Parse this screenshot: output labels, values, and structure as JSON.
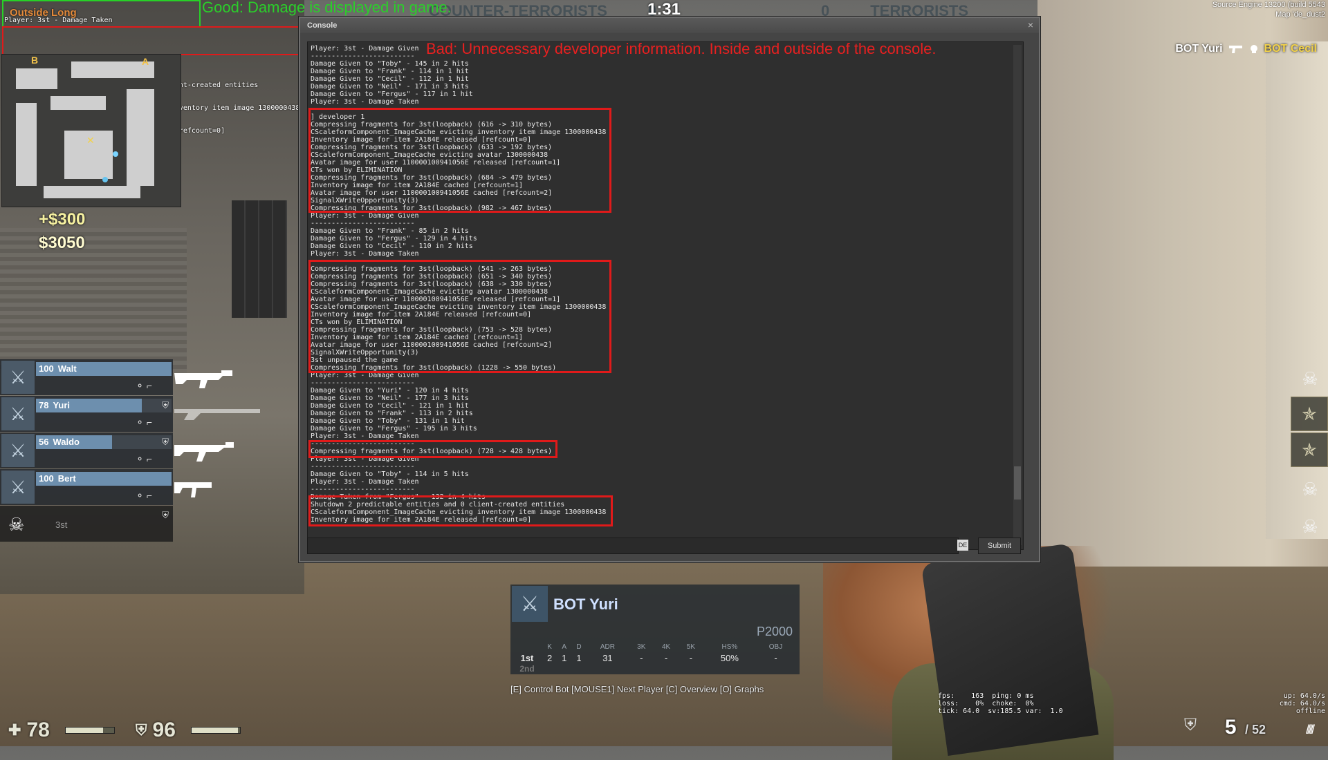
{
  "top": {
    "timer": "1:31",
    "team_left": "COUNTER-TERRORISTS",
    "team_left_score": "0",
    "team_right": "TERRORISTS",
    "team_right_score": "0",
    "engine_line1": "Source Engine 13200 (build 5543",
    "engine_line2": "Map 'de_dust2"
  },
  "killfeed": {
    "killer": "BOT Yuri",
    "victim": "BOT Cecil"
  },
  "overlay": {
    "line1": "Player: 3st - Damage Taken",
    "location": "Outside Long",
    "line2": "Damage Taken from \"Fergus\" - 132 in 4 hits",
    "dev1": "Shutdown 2 predictable entities and 0 client-created entities",
    "dev2": "CScaleformComponent_ImageCache evicting inventory item image 1300000438",
    "dev3": "Inventory image for item 2A184E released [refcount=0]"
  },
  "annotations": {
    "good": "Good: Damage is displayed in game.",
    "bad": "Bad: Unnecessary developer information. Inside and outside of the console."
  },
  "radar": {
    "site_b": "B",
    "site_a": "A"
  },
  "money": {
    "delta": "+$300",
    "total": "$3050"
  },
  "team": [
    {
      "hp": "100",
      "name": "Walt",
      "hp_frac": 1.0,
      "armor": ""
    },
    {
      "hp": "78",
      "name": "Yuri",
      "hp_frac": 0.78,
      "armor": "⛨"
    },
    {
      "hp": "56",
      "name": "Waldo",
      "hp_frac": 0.56,
      "armor": "⛨"
    },
    {
      "hp": "100",
      "name": "Bert",
      "hp_frac": 1.0,
      "armor": ""
    },
    {
      "hp": "",
      "name": "3st",
      "hp_frac": 0,
      "armor": "⛨",
      "dead": true
    }
  ],
  "console": {
    "title": "Console",
    "close": "×",
    "lang": "DE",
    "submit": "Submit",
    "lines": [
      "Player: 3st - Damage Given",
      "-------------------------",
      "Damage Given to \"Toby\" - 145 in 2 hits",
      "Damage Given to \"Frank\" - 114 in 1 hit",
      "Damage Given to \"Cecil\" - 112 in 1 hit",
      "Damage Given to \"Neil\" - 171 in 3 hits",
      "Damage Given to \"Fergus\" - 117 in 1 hit",
      "Player: 3st - Damage Taken",
      "-------------------------",
      "",
      "] developer 1",
      "Compressing fragments for 3st(loopback) (616 -> 310 bytes)",
      "CScaleformComponent_ImageCache evicting inventory item image 1300000438",
      "Inventory image for item 2A184E released [refcount=0]",
      "Compressing fragments for 3st(loopback) (633 -> 192 bytes)",
      "CScaleformComponent_ImageCache evicting avatar 1300000438",
      "Avatar image for user 110000100941056E released [refcount=1]",
      "CTs won by ELIMINATION",
      "Compressing fragments for 3st(loopback) (684 -> 479 bytes)",
      "Inventory image for item 2A184E cached [refcount=1]",
      "Avatar image for user 110000100941056E cached [refcount=2]",
      "SignalXWriteOpportunity(3)",
      "Compressing fragments for 3st(loopback) (982 -> 467 bytes)",
      "Player: 3st - Damage Given",
      "-------------------------",
      "Damage Given to \"Frank\" - 85 in 2 hits",
      "Damage Given to \"Fergus\" - 129 in 4 hits",
      "Damage Given to \"Cecil\" - 110 in 2 hits",
      "Player: 3st - Damage Taken",
      "-------------------------",
      "",
      "Compressing fragments for 3st(loopback) (541 -> 263 bytes)",
      "Compressing fragments for 3st(loopback) (651 -> 340 bytes)",
      "Compressing fragments for 3st(loopback) (638 -> 330 bytes)",
      "CScaleformComponent_ImageCache evicting avatar 1300000438",
      "Avatar image for user 110000100941056E released [refcount=1]",
      "CScaleformComponent_ImageCache evicting inventory item image 1300000438",
      "Inventory image for item 2A184E released [refcount=0]",
      "CTs won by ELIMINATION",
      "Compressing fragments for 3st(loopback) (753 -> 528 bytes)",
      "Inventory image for item 2A184E cached [refcount=1]",
      "Avatar image for user 110000100941056E cached [refcount=2]",
      "SignalXWriteOpportunity(3)",
      "3st unpaused the game",
      "Compressing fragments for 3st(loopback) (1228 -> 550 bytes)",
      "Player: 3st - Damage Given",
      "-------------------------",
      "Damage Given to \"Yuri\" - 120 in 4 hits",
      "Damage Given to \"Neil\" - 177 in 3 hits",
      "Damage Given to \"Cecil\" - 121 in 1 hit",
      "Damage Given to \"Frank\" - 113 in 2 hits",
      "Damage Given to \"Toby\" - 131 in 1 hit",
      "Damage Given to \"Fergus\" - 195 in 3 hits",
      "Player: 3st - Damage Taken",
      "-------------------------",
      "Compressing fragments for 3st(loopback) (728 -> 428 bytes)",
      "Player: 3st - Damage Given",
      "-------------------------",
      "Damage Given to \"Toby\" - 114 in 5 hits",
      "Player: 3st - Damage Taken",
      "-------------------------",
      "Damage Taken from \"Fergus\" - 132 in 4 hits",
      "Shutdown 2 predictable entities and 0 client-created entities",
      "CScaleformComponent_ImageCache evicting inventory item image 1300000438",
      "Inventory image for item 2A184E released [refcount=0]"
    ]
  },
  "spectator": {
    "name": "BOT Yuri",
    "weapon": "P2000",
    "headers": [
      "K",
      "A",
      "D",
      "ADR",
      "3K",
      "4K",
      "5K",
      "HS%",
      "OBJ"
    ],
    "row_label": "1st",
    "row2_label": "2nd",
    "values": [
      "2",
      "1",
      "1",
      "31",
      "-",
      "-",
      "-",
      "50%",
      "-"
    ],
    "hint": "[E] Control Bot  [MOUSE1] Next Player [C] Overview  [O] Graphs"
  },
  "netgraph": {
    "left": "fps:    163  ping: 0 ms\nloss:    0%  choke:  0%\ntick: 64.0  sv:185.5 var:  1.0",
    "right": "up: 64.0/s\ncmd: 64.0/s\noffline"
  },
  "hud": {
    "health": "78",
    "health_frac": 0.78,
    "armor": "96",
    "armor_frac": 0.96,
    "ammo": "5",
    "reserve": "/ 52"
  }
}
